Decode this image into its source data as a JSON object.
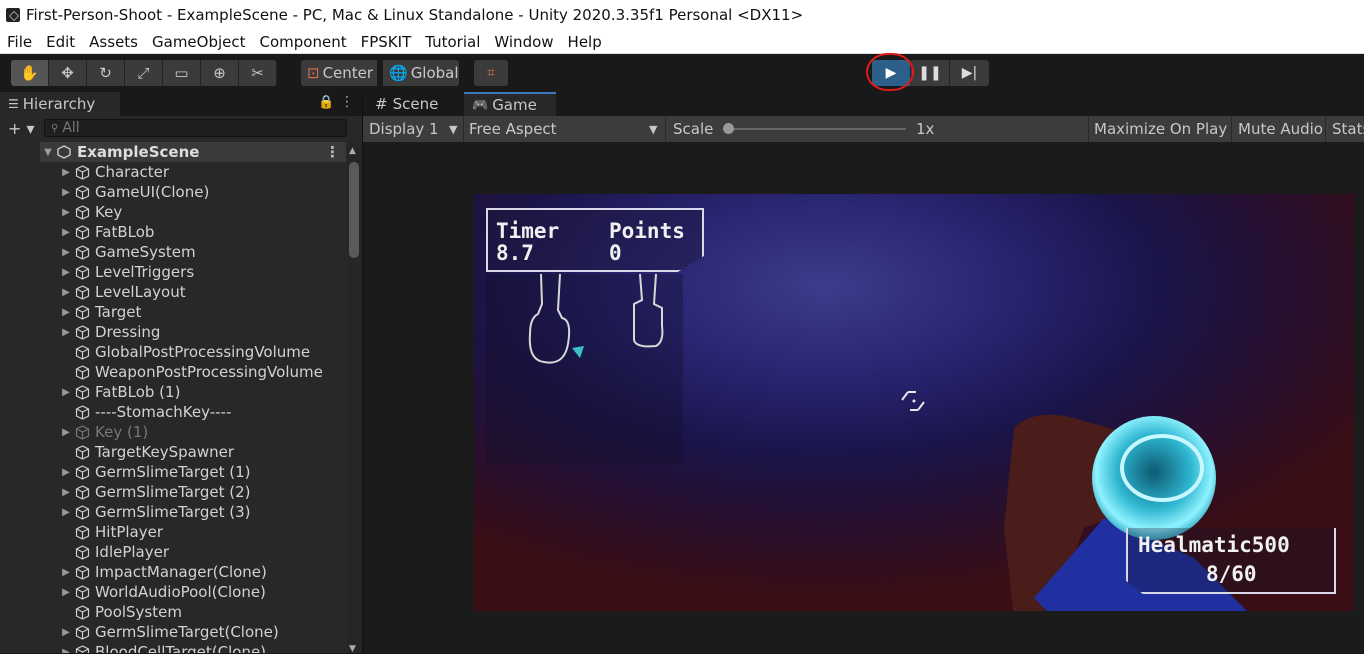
{
  "window": {
    "title": "First-Person-Shoot - ExampleScene - PC, Mac & Linux Standalone - Unity 2020.3.35f1 Personal <DX11>"
  },
  "menu": [
    "File",
    "Edit",
    "Assets",
    "GameObject",
    "Component",
    "FPSKIT",
    "Tutorial",
    "Window",
    "Help"
  ],
  "toolbar": {
    "tools": [
      "hand-icon",
      "move-icon",
      "rotate-icon",
      "scale-icon",
      "rect-icon",
      "transform-icon",
      "custom-tool-icon"
    ],
    "pivot": "Center",
    "space": "Global",
    "play_state": "play",
    "highlight_color": "#e41a1a",
    "play_color": "#2d5f8b"
  },
  "hierarchy": {
    "tab": "Hierarchy",
    "search_placeholder": "All",
    "scene": "ExampleScene",
    "items": [
      {
        "label": "Character",
        "expandable": true
      },
      {
        "label": "GameUI(Clone)",
        "expandable": true
      },
      {
        "label": "Key",
        "expandable": true
      },
      {
        "label": "FatBLob",
        "expandable": true
      },
      {
        "label": "GameSystem",
        "expandable": true
      },
      {
        "label": "LevelTriggers",
        "expandable": true
      },
      {
        "label": "LevelLayout",
        "expandable": true
      },
      {
        "label": "Target",
        "expandable": true
      },
      {
        "label": "Dressing",
        "expandable": true
      },
      {
        "label": "GlobalPostProcessingVolume",
        "expandable": false
      },
      {
        "label": "WeaponPostProcessingVolume",
        "expandable": false
      },
      {
        "label": "FatBLob (1)",
        "expandable": true
      },
      {
        "label": "----StomachKey----",
        "expandable": false
      },
      {
        "label": "Key (1)",
        "expandable": true,
        "disabled": true
      },
      {
        "label": "TargetKeySpawner",
        "expandable": false
      },
      {
        "label": "GermSlimeTarget (1)",
        "expandable": true
      },
      {
        "label": "GermSlimeTarget (2)",
        "expandable": true
      },
      {
        "label": "GermSlimeTarget (3)",
        "expandable": true
      },
      {
        "label": "HitPlayer",
        "expandable": false
      },
      {
        "label": "IdlePlayer",
        "expandable": false
      },
      {
        "label": "ImpactManager(Clone)",
        "expandable": true
      },
      {
        "label": "WorldAudioPool(Clone)",
        "expandable": true
      },
      {
        "label": "PoolSystem",
        "expandable": false
      },
      {
        "label": "GermSlimeTarget(Clone)",
        "expandable": true
      },
      {
        "label": "BloodCellTarget(Clone)",
        "expandable": true
      }
    ]
  },
  "views": {
    "scene_tab": "Scene",
    "game_tab": "Game",
    "display": "Display 1",
    "aspect": "Free Aspect",
    "scale_label": "Scale",
    "scale_value": "1x",
    "maximize": "Maximize On Play",
    "mute": "Mute Audio",
    "stats": "Stats"
  },
  "hud": {
    "timer_label": "Timer",
    "timer_value": "8.7",
    "points_label": "Points",
    "points_value": "0",
    "weapon_name": "Healmatic500",
    "ammo": "8/60"
  }
}
